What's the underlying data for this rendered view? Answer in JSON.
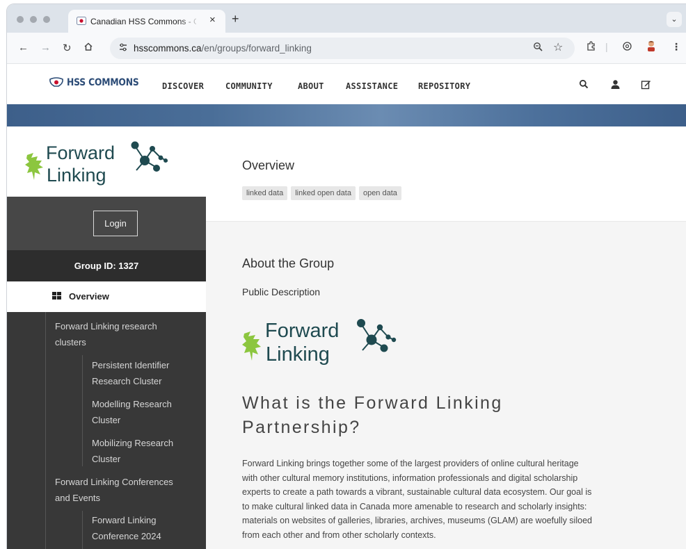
{
  "browser": {
    "tab_title": "Canadian HSS Commons - Gr",
    "tab_close": "×",
    "new_tab": "+",
    "url_host": "hsscommons.ca",
    "url_path": "/en/groups/forward_linking",
    "icons": [
      "back-icon",
      "forward-icon",
      "reload-icon",
      "home-icon",
      "site-settings-icon",
      "zoom-icon",
      "bookmark-star-icon",
      "extensions-icon",
      "circle-icon",
      "profile-avatar-icon",
      "menu-icon",
      "tab-dropdown-icon"
    ]
  },
  "header": {
    "logo_text": "HSS COMMONS",
    "nav": [
      "DISCOVER",
      "COMMUNITY",
      "ABOUT",
      "ASSISTANCE",
      "REPOSITORY"
    ],
    "icons": [
      "search-icon",
      "user-icon",
      "edit-icon"
    ]
  },
  "sidebar": {
    "group_logo": {
      "line1": "Forward",
      "line2": "Linking"
    },
    "login_label": "Login",
    "group_id": "Group ID: 1327",
    "overview_label": "Overview",
    "items": [
      {
        "label_line1": "Forward Linking research",
        "label_line2": "clusters",
        "level": 1
      },
      {
        "label_line1": "Persistent Identifier",
        "label_line2": "Research Cluster",
        "level": 2
      },
      {
        "label_line1": "Modelling Research",
        "label_line2": "Cluster",
        "level": 2
      },
      {
        "label_line1": "Mobilizing Research",
        "label_line2": "Cluster",
        "level": 2
      },
      {
        "label_line1": "Forward Linking Conferences",
        "label_line2": "and Events",
        "level": 1
      },
      {
        "label_line1": "Forward Linking",
        "label_line2": "Conference 2024",
        "level": 2
      }
    ]
  },
  "main": {
    "title": "Overview",
    "tags": [
      "linked data",
      "linked open data",
      "open data"
    ],
    "about_heading": "About the Group",
    "public_description_label": "Public Description",
    "logo": {
      "line1": "Forward",
      "line2": "Linking"
    },
    "headline_line1": "What is the Forward Linking",
    "headline_line2": "Partnership?",
    "paragraph_lines": [
      "Forward Linking brings together some of the largest providers of online cultural heritage",
      "with other cultural memory institutions, information professionals and digital scholarship",
      "experts to create a path towards a vibrant, sustainable cultural data ecosystem. Our goal is",
      "to make cultural linked data in Canada more amenable to research and scholarly insights:",
      "materials on websites of galleries, libraries, archives, museums (GLAM) are woefully siloed",
      "from each other and from other scholarly contexts."
    ]
  },
  "colors": {
    "brand_blue": "#2b4b76",
    "logo_teal": "#1f4a50",
    "logo_green": "#8cc63f",
    "sidebar_dark": "#383838",
    "group_id_bg": "#2d2d2d"
  }
}
